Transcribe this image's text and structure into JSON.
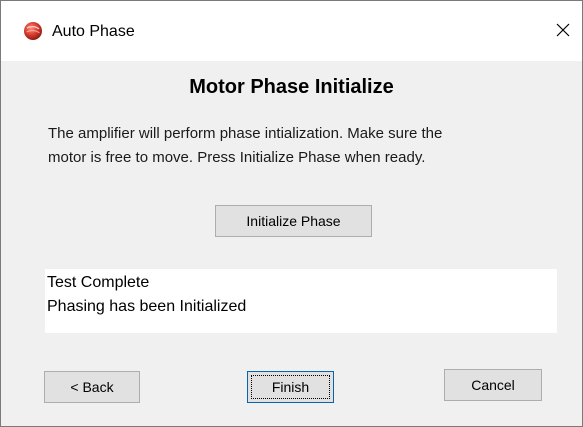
{
  "window": {
    "title": "Auto Phase",
    "icon": "app-logo-icon",
    "close_icon": "close-icon"
  },
  "heading": "Motor Phase Initialize",
  "description": {
    "line1": "The amplifier  will perform phase intialization. Make sure the",
    "line2": "motor is free to move.  Press Initialize Phase when ready."
  },
  "buttons": {
    "initialize": "Initialize Phase",
    "back": "< Back",
    "finish": "Finish",
    "cancel": "Cancel"
  },
  "result": {
    "line1": "Test Complete",
    "line2": "Phasing has been Initialized"
  },
  "colors": {
    "dialog_bg": "#f0f0f0",
    "titlebar_bg": "#ffffff",
    "button_bg": "#e1e1e1",
    "focus_border": "#0a64ad",
    "icon_red": "#c0392b"
  }
}
